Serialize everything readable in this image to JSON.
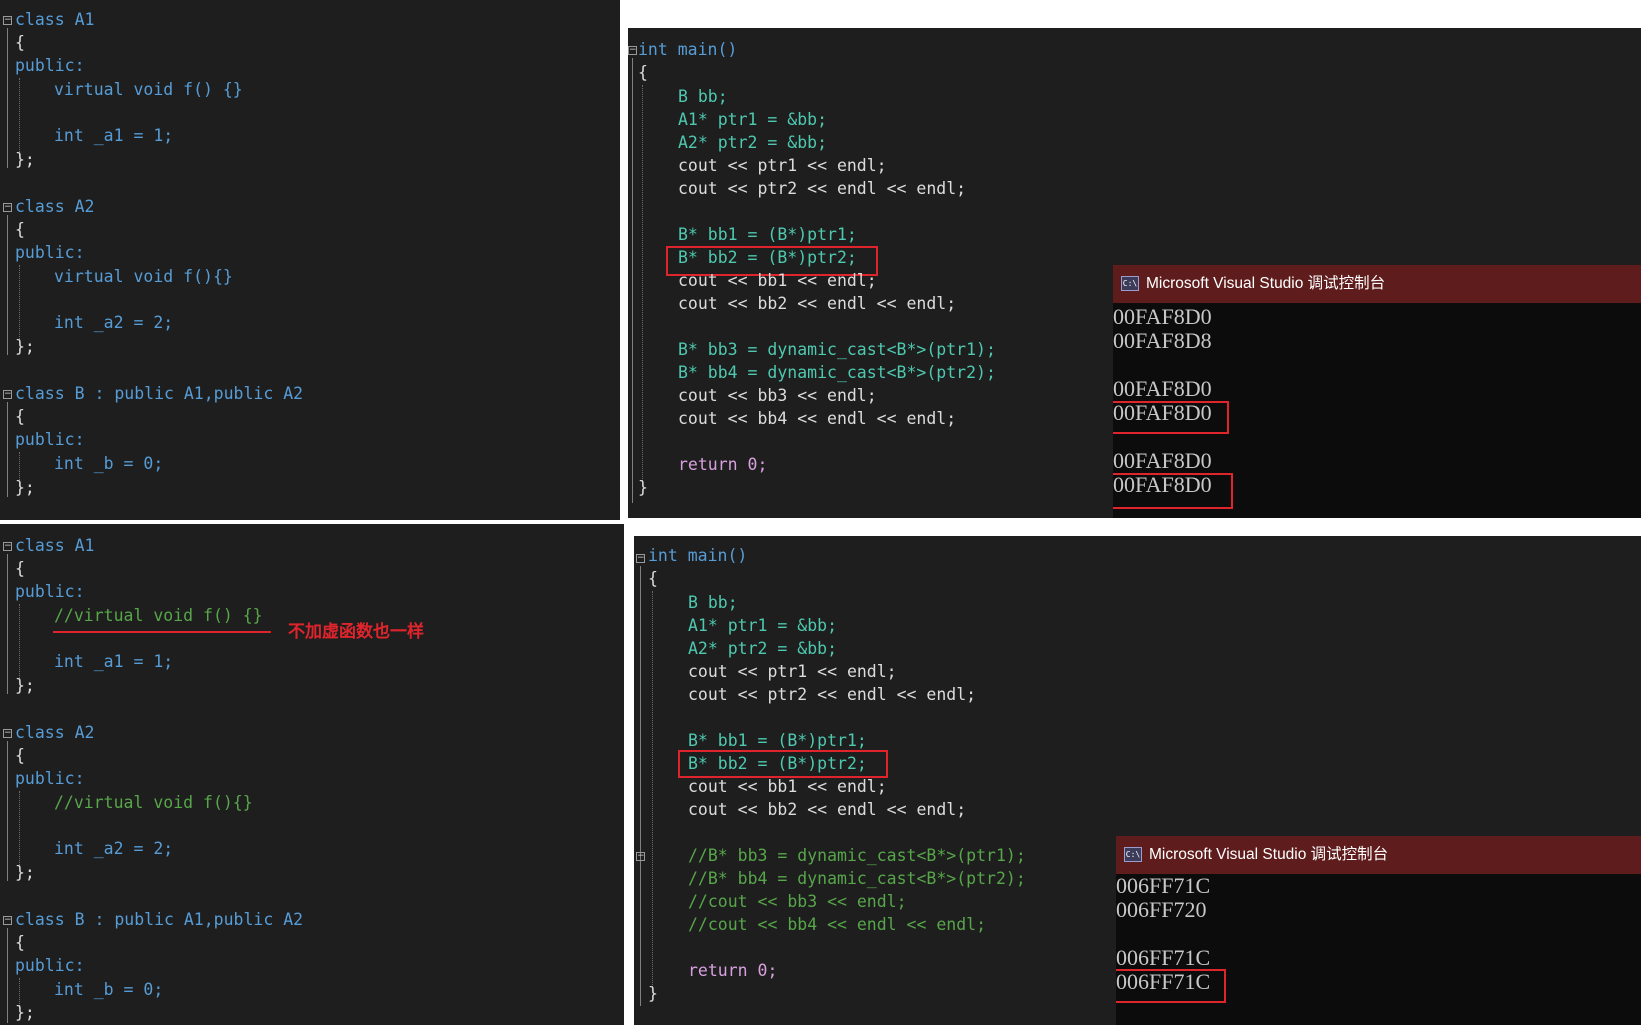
{
  "top_left_code": {
    "class_a1_head": "class A1",
    "a1_open": "{",
    "a1_public": "public:",
    "a1_virtual": "virtual void f() {}",
    "a1_member": "int _a1 = 1;",
    "a1_close": "};",
    "class_a2_head": "class A2",
    "a2_open": "{",
    "a2_public": "public:",
    "a2_virtual": "virtual void f(){}",
    "a2_member": "int _a2 = 2;",
    "a2_close": "};",
    "class_b_head": "class B : public A1,public A2",
    "b_open": "{",
    "b_public": "public:",
    "b_member": "int _b = 0;",
    "b_close": "};"
  },
  "top_right_code": {
    "main_sig": "int main()",
    "open": "{",
    "l1": "B bb;",
    "l2": "A1* ptr1 = &bb;",
    "l3": "A2* ptr2 = &bb;",
    "l4": "cout << ptr1 << endl;",
    "l5": "cout << ptr2 << endl << endl;",
    "l6": "B* bb1 = (B*)ptr1;",
    "l7": "B* bb2 = (B*)ptr2;",
    "l8": "cout << bb1 << endl;",
    "l9": "cout << bb2 << endl << endl;",
    "l10": "B* bb3 = dynamic_cast<B*>(ptr1);",
    "l11": "B* bb4 = dynamic_cast<B*>(ptr2);",
    "l12": "cout << bb3 << endl;",
    "l13": "cout << bb4 << endl << endl;",
    "l14": "return 0;",
    "close": "}"
  },
  "top_console": {
    "title": "Microsoft Visual Studio 调试控制台",
    "icon": "console-app-icon",
    "lines": [
      "00FAF8D0",
      "00FAF8D8",
      "",
      "00FAF8D0",
      "00FAF8D0",
      "",
      "00FAF8D0",
      "00FAF8D0"
    ]
  },
  "bottom_left_code": {
    "class_a1_head": "class A1",
    "a1_open": "{",
    "a1_public": "public:",
    "a1_virtual": "//virtual void f() {}",
    "a1_member": "int _a1 = 1;",
    "a1_close": "};",
    "class_a2_head": "class A2",
    "a2_open": "{",
    "a2_public": "public:",
    "a2_virtual": "//virtual void f(){}",
    "a2_member": "int _a2 = 2;",
    "a2_close": "};",
    "class_b_head": "class B : public A1,public A2",
    "b_open": "{",
    "b_public": "public:",
    "b_member": "int _b = 0;",
    "b_close": "};"
  },
  "annotation": {
    "text": "不加虚函数也一样",
    "color": "#e0242c"
  },
  "bottom_right_code": {
    "main_sig": "int main()",
    "open": "{",
    "l1": "B bb;",
    "l2": "A1* ptr1 = &bb;",
    "l3": "A2* ptr2 = &bb;",
    "l4": "cout << ptr1 << endl;",
    "l5": "cout << ptr2 << endl << endl;",
    "l6": "B* bb1 = (B*)ptr1;",
    "l7": "B* bb2 = (B*)ptr2;",
    "l8": "cout << bb1 << endl;",
    "l9": "cout << bb2 << endl << endl;",
    "l10": "//B* bb3 = dynamic_cast<B*>(ptr1);",
    "l11": "//B* bb4 = dynamic_cast<B*>(ptr2);",
    "l12": "//cout << bb3 << endl;",
    "l13": "//cout << bb4 << endl << endl;",
    "l14": "return 0;",
    "close": "}"
  },
  "bottom_console": {
    "title": "Microsoft Visual Studio 调试控制台",
    "icon": "console-app-icon",
    "lines": [
      "006FF71C",
      "006FF720",
      "",
      "006FF71C",
      "006FF71C"
    ]
  },
  "colors": {
    "editor_bg": "#1e1e1e",
    "keyword": "#569cd6",
    "type": "#4ec9b0",
    "variable": "#9cdcfe",
    "function": "#dcdcaa",
    "comment": "#57a64a",
    "highlight_box": "#e0242c",
    "console_title_bg": "#5f1c1c"
  }
}
